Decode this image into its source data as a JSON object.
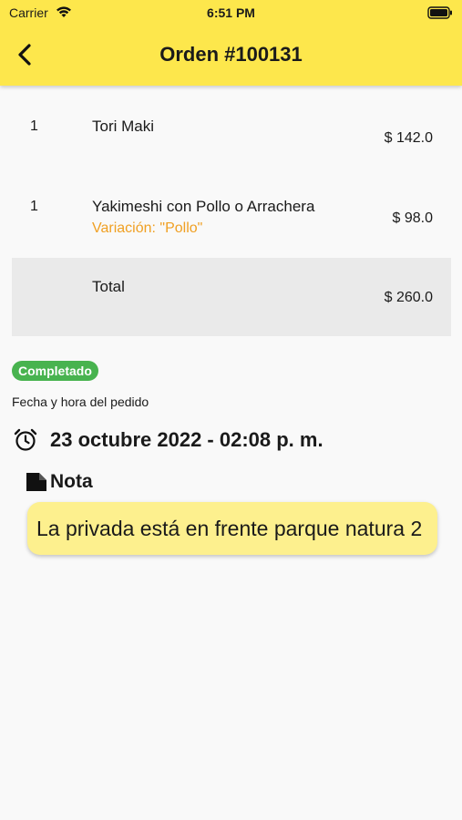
{
  "status_bar": {
    "carrier": "Carrier",
    "time": "6:51 PM"
  },
  "header": {
    "title": "Orden #100131"
  },
  "items": [
    {
      "qty": "1",
      "name": "Tori Maki",
      "price": "$ 142.0"
    },
    {
      "qty": "1",
      "name": "Yakimeshi con Pollo o Arrachera",
      "variation": "Variación: \"Pollo\"",
      "price": "$ 98.0"
    }
  ],
  "total": {
    "label": "Total",
    "value": "$ 260.0"
  },
  "order": {
    "status": "Completado",
    "status_color": "#48b34f",
    "date_label": "Fecha y hora del pedido",
    "datetime": "23 octubre 2022 - 02:08 p. m."
  },
  "note": {
    "label": "Nota",
    "text": "La privada está en frente parque natura 2"
  },
  "colors": {
    "header_bg": "#fde74c",
    "note_bg": "#fdf08e",
    "variation": "#f0a023"
  }
}
